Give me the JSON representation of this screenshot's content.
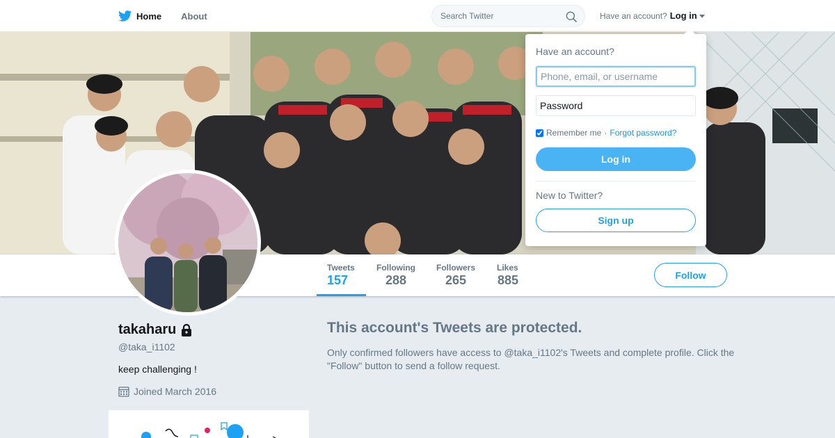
{
  "nav": {
    "home_label": "Home",
    "about_label": "About",
    "search_placeholder": "Search Twitter",
    "have_account_text": "Have an account?",
    "login_label": "Log in"
  },
  "login_dropdown": {
    "heading": "Have an account?",
    "username_placeholder": "Phone, email, or username",
    "password_placeholder": "Password",
    "remember_label": "Remember me",
    "separator": "·",
    "forgot_label": "Forgot password?",
    "login_button": "Log in",
    "new_text": "New to Twitter?",
    "signup_button": "Sign up"
  },
  "profile": {
    "name": "takaharu",
    "handle": "@taka_i1102",
    "bio": "keep challenging !",
    "joined": "Joined March 2016",
    "follow_label": "Follow"
  },
  "stats": [
    {
      "label": "Tweets",
      "value": "157",
      "active": true
    },
    {
      "label": "Following",
      "value": "288",
      "active": false
    },
    {
      "label": "Followers",
      "value": "265",
      "active": false
    },
    {
      "label": "Likes",
      "value": "885",
      "active": false
    }
  ],
  "protected": {
    "title": "This account's Tweets are protected.",
    "text": "Only confirmed followers have access to @taka_i1102's Tweets and complete profile. Click the \"Follow\" button to send a follow request."
  },
  "icons": {
    "logo": "twitter-bird-icon",
    "search": "search-icon",
    "lock": "lock-icon",
    "calendar": "calendar-icon"
  },
  "colors": {
    "accent": "#1da1f2",
    "login_button": "#4ab3f4",
    "muted_text": "#657786",
    "page_background": "#e6ecf0"
  }
}
